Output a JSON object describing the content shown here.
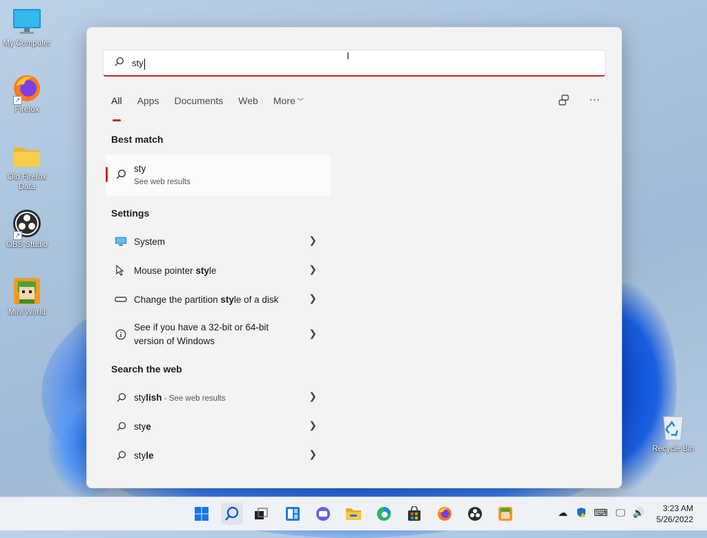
{
  "desktop": {
    "icons": [
      {
        "label": "My Computer",
        "icon": "monitor-icon"
      },
      {
        "label": "Firefox",
        "icon": "firefox-icon"
      },
      {
        "label": "Old Firefox Data",
        "icon": "folder-icon"
      },
      {
        "label": "OBS Studio",
        "icon": "obs-icon"
      },
      {
        "label": "Mini World",
        "icon": "mini-world-icon"
      },
      {
        "label": "Recycle Bin",
        "icon": "recycle-bin-icon"
      }
    ]
  },
  "search": {
    "query": "sty"
  },
  "tabs": [
    {
      "label": "All",
      "active": true
    },
    {
      "label": "Apps"
    },
    {
      "label": "Documents"
    },
    {
      "label": "Web"
    },
    {
      "label": "More"
    }
  ],
  "best_match": {
    "heading": "Best match",
    "title": "sty",
    "subtitle": "See web results"
  },
  "settings": {
    "heading": "Settings",
    "items": [
      {
        "pre": "System",
        "bold": "",
        "post": "",
        "icon": "system-display-icon"
      },
      {
        "pre": "Mouse pointer ",
        "bold": "sty",
        "post": "le",
        "icon": "mouse-pointer-icon"
      },
      {
        "pre": "Change the partition ",
        "bold": "sty",
        "post": "le of a disk",
        "icon": "disk-icon"
      },
      {
        "pre": "See if you have a 32-bit or 64-bit",
        "bold": "",
        "post": "",
        "line2": "version of Windows",
        "icon": "info-icon"
      }
    ]
  },
  "web": {
    "heading": "Search the web",
    "items": [
      {
        "pre": "sty",
        "bold": "lish",
        "suffix": " - See web results"
      },
      {
        "pre": "sty",
        "bold": "e",
        "suffix": ""
      },
      {
        "pre": "sty",
        "bold": "le",
        "suffix": ""
      }
    ]
  },
  "taskbar": {
    "apps": [
      "windows-start-icon",
      "search-icon",
      "task-view-icon",
      "widgets-icon",
      "chat-icon",
      "file-explorer-icon",
      "edge-icon",
      "store-icon",
      "firefox-icon",
      "obs-icon",
      "mini-world-icon"
    ],
    "time": "3:23 AM",
    "date": "5/26/2022"
  },
  "colors": {
    "accent": "#c42b1c",
    "panel": "#f3f3f3"
  }
}
